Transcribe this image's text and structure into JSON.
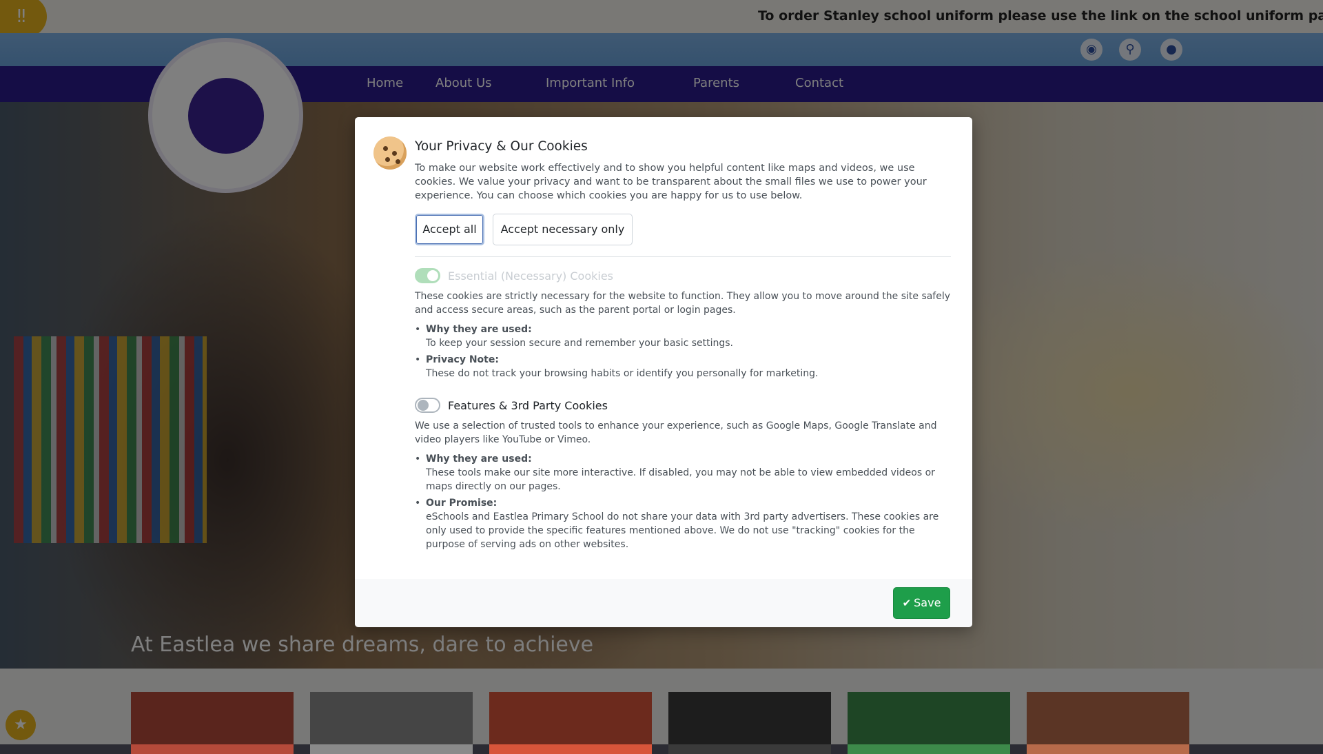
{
  "background": {
    "ticker_text": "To order Stanley school uniform please use the link on the school uniform page.",
    "nav": [
      "Home",
      "About Us",
      "Important Info",
      "Parents",
      "Contact"
    ],
    "hero_caption": "At Eastlea we share dreams, dare to achieve"
  },
  "modal": {
    "title": "Your Privacy & Our Cookies",
    "intro": "To make our website work effectively and to show you helpful content like maps and videos, we use cookies. We value your privacy and want to be transparent about the small files we use to power your experience. You can choose which cookies you are happy for us to use below.",
    "accept_all_label": "Accept all",
    "accept_necessary_label": "Accept necessary only",
    "essential": {
      "title": "Essential (Necessary) Cookies",
      "enabled": true,
      "description": "These cookies are strictly necessary for the website to function. They allow you to move around the site safely and access secure areas, such as the parent portal or login pages.",
      "bullets": [
        {
          "heading": "Why they are used:",
          "text": "To keep your session secure and remember your basic settings."
        },
        {
          "heading": "Privacy Note:",
          "text": "These do not track your browsing habits or identify you personally for marketing."
        }
      ]
    },
    "features": {
      "title": "Features & 3rd Party Cookies",
      "enabled": false,
      "description": "We use a selection of trusted tools to enhance your experience, such as Google Maps, Google Translate and video players like YouTube or Vimeo.",
      "bullets": [
        {
          "heading": "Why they are used:",
          "text": "These tools make our site more interactive. If disabled, you may not be able to view embedded videos or maps directly on our pages."
        },
        {
          "heading": "Our Promise:",
          "text": "eSchools and Eastlea Primary School do not share your data with 3rd party advertisers. These cookies are only used to provide the specific features mentioned above. We do not use \"tracking\" cookies for the purpose of serving ads on other websites."
        }
      ]
    },
    "save_label": "Save"
  },
  "colors": {
    "save_button": "#1e9e4a",
    "nav_background": "#2a1a8c",
    "toggle_on": "#8fd19e"
  },
  "icons": {
    "cookie": "cookie-icon",
    "save": "check-icon",
    "ticker": "megaphone-icon"
  }
}
